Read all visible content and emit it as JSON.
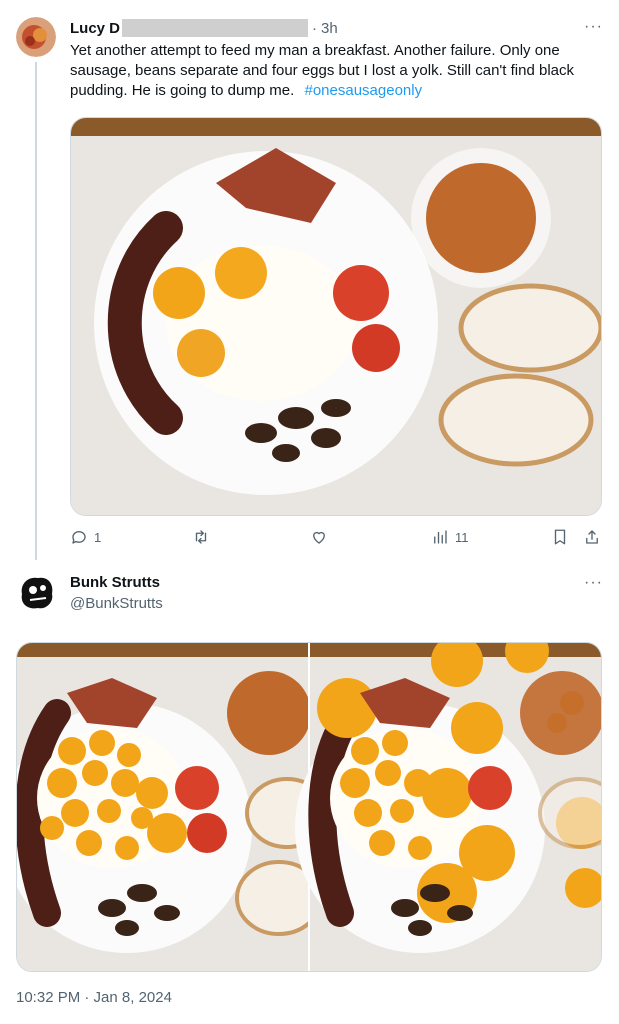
{
  "tweet1": {
    "author_name": "Lucy D",
    "time": "3h",
    "text": "Yet another attempt to feed my man a breakfast. Another failure. Only one sausage, beans separate and four eggs but I lost a yolk. Still can't find black pudding. He is going to dump me.",
    "hashtag": "#onesausageonly",
    "actions": {
      "replies": "1",
      "views": "11"
    }
  },
  "tweet2": {
    "author_name": "Bunk Strutts",
    "handle": "@BunkStrutts",
    "timestamp": "10:32 PM · Jan 8, 2024"
  },
  "icons": {
    "more": "more-icon",
    "reply": "reply-icon",
    "retweet": "retweet-icon",
    "like": "heart-icon",
    "views": "views-icon",
    "bookmark": "bookmark-icon",
    "share": "share-icon"
  },
  "colors": {
    "accent": "#1d9bf0",
    "muted": "#536471"
  }
}
